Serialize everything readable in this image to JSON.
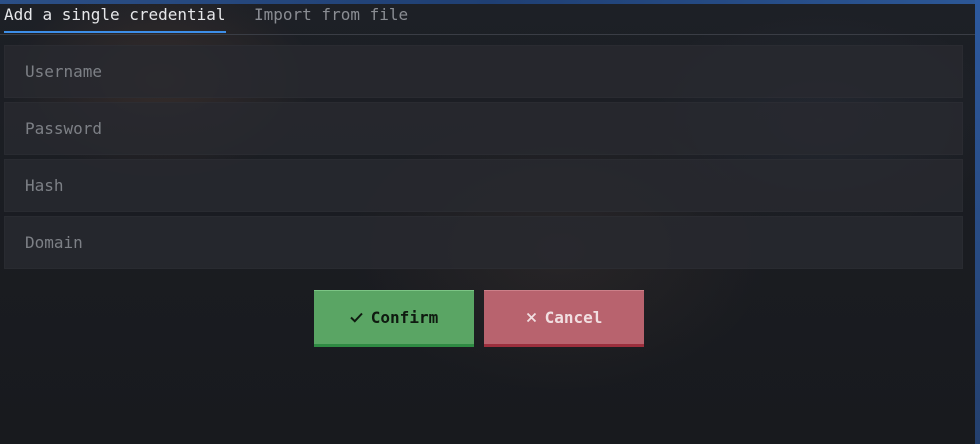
{
  "tabs": {
    "active_label": "Add a single credential",
    "inactive_label": "Import from file"
  },
  "form": {
    "username": {
      "value": "",
      "placeholder": "Username"
    },
    "password": {
      "value": "",
      "placeholder": "Password"
    },
    "hash": {
      "value": "",
      "placeholder": "Hash"
    },
    "domain": {
      "value": "",
      "placeholder": "Domain"
    }
  },
  "actions": {
    "confirm_label": "Confirm",
    "confirm_icon": "check-icon",
    "cancel_label": "Cancel",
    "cancel_icon": "close-icon"
  },
  "colors": {
    "accent": "#3d8ee8",
    "confirm": "#5aa564",
    "cancel": "#b8636e"
  }
}
